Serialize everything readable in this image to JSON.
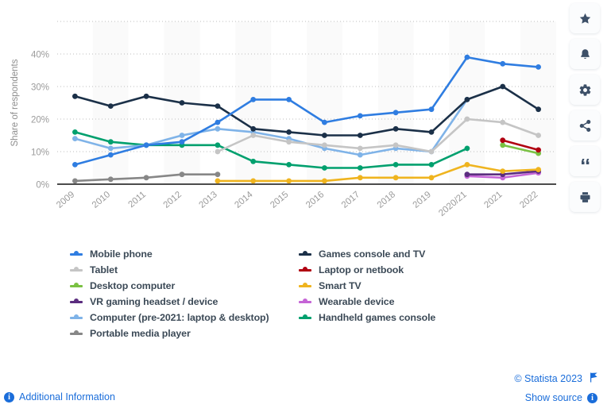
{
  "chart_data": {
    "type": "line",
    "title": "",
    "xlabel": "",
    "ylabel": "Share of respondents",
    "ylim": [
      0,
      50
    ],
    "yticks": [
      0,
      10,
      20,
      30,
      40
    ],
    "ytick_labels": [
      "0%",
      "10%",
      "20%",
      "30%",
      "40%"
    ],
    "grid": true,
    "legend_position": "bottom",
    "categories": [
      "2009",
      "2010",
      "2011",
      "2012",
      "2013",
      "2014",
      "2015",
      "2016",
      "2017",
      "2018",
      "2019",
      "2020/21",
      "2021",
      "2022"
    ],
    "series": [
      {
        "name": "Mobile phone",
        "color": "#2f7de1",
        "values": [
          6,
          9,
          12,
          13,
          19,
          26,
          26,
          19,
          21,
          22,
          23,
          39,
          37,
          36
        ]
      },
      {
        "name": "Games console and TV",
        "color": "#1b3048",
        "values": [
          27,
          24,
          27,
          25,
          24,
          17,
          16,
          15,
          15,
          17,
          16,
          26,
          30,
          23
        ]
      },
      {
        "name": "Tablet",
        "color": "#c5c5c5",
        "values": [
          null,
          null,
          null,
          null,
          10,
          15,
          13,
          12,
          11,
          12,
          10,
          20,
          19,
          15
        ]
      },
      {
        "name": "Laptop or netbook",
        "color": "#b00010",
        "values": [
          null,
          null,
          null,
          null,
          null,
          null,
          null,
          null,
          null,
          null,
          null,
          null,
          13.5,
          10.5
        ]
      },
      {
        "name": "Desktop computer",
        "color": "#7ac143",
        "values": [
          null,
          null,
          null,
          null,
          null,
          null,
          null,
          null,
          null,
          null,
          null,
          null,
          12,
          9.5
        ]
      },
      {
        "name": "Smart TV",
        "color": "#efb41f",
        "values": [
          null,
          null,
          null,
          null,
          1,
          1,
          1,
          1,
          2,
          2,
          2,
          6,
          4,
          4.5
        ]
      },
      {
        "name": "VR gaming headset / device",
        "color": "#5b2d7f",
        "values": [
          null,
          null,
          null,
          null,
          null,
          null,
          null,
          null,
          null,
          null,
          null,
          3,
          3,
          4
        ]
      },
      {
        "name": "Wearable device",
        "color": "#c565d6",
        "values": [
          null,
          null,
          null,
          null,
          null,
          null,
          null,
          null,
          null,
          null,
          null,
          2.5,
          2,
          3.5
        ]
      },
      {
        "name": "Computer (pre-2021: laptop & desktop)",
        "color": "#7fb3e8",
        "values": [
          14,
          11,
          12,
          15,
          17,
          16,
          14,
          11,
          9,
          11,
          10,
          26,
          null,
          null
        ]
      },
      {
        "name": "Handheld games console",
        "color": "#00a06e",
        "values": [
          16,
          13,
          12,
          12,
          12,
          7,
          6,
          5,
          5,
          6,
          6,
          11,
          null,
          null
        ]
      },
      {
        "name": "Portable media player",
        "color": "#878787",
        "values": [
          1,
          1.5,
          2,
          3,
          3,
          null,
          null,
          null,
          null,
          null,
          null,
          null,
          null,
          null
        ]
      }
    ]
  },
  "legend": {
    "rows": [
      {
        "left": {
          "label": "Mobile phone",
          "color": "#2f7de1",
          "name": "mobile-phone"
        },
        "right": {
          "label": "Games console and TV",
          "color": "#1b3048",
          "name": "games-console-and-tv"
        }
      },
      {
        "left": {
          "label": "Tablet",
          "color": "#c5c5c5",
          "name": "tablet"
        },
        "right": {
          "label": "Laptop or netbook",
          "color": "#b00010",
          "name": "laptop-or-netbook"
        }
      },
      {
        "left": {
          "label": "Desktop computer",
          "color": "#7ac143",
          "name": "desktop-computer"
        },
        "right": {
          "label": "Smart TV",
          "color": "#efb41f",
          "name": "smart-tv"
        }
      },
      {
        "left": {
          "label": "VR gaming headset / device",
          "color": "#5b2d7f",
          "name": "vr-gaming-headset"
        },
        "right": {
          "label": "Wearable device",
          "color": "#c565d6",
          "name": "wearable-device"
        }
      },
      {
        "left": {
          "label": "Computer (pre-2021: laptop & desktop)",
          "color": "#7fb3e8",
          "name": "computer"
        },
        "right": {
          "label": "Handheld games console",
          "color": "#00a06e",
          "name": "handheld-games-console"
        }
      },
      {
        "left": {
          "label": "Portable media player",
          "color": "#878787",
          "name": "portable-media-player"
        },
        "right": null
      }
    ]
  },
  "toolbar": {
    "buttons": [
      {
        "name": "favorite-star-icon",
        "label": "star-icon"
      },
      {
        "name": "notification-bell-icon",
        "label": "bell-icon"
      },
      {
        "name": "settings-gear-icon",
        "label": "gear-icon"
      },
      {
        "name": "share-icon",
        "label": "share-icon"
      },
      {
        "name": "citation-quote-icon",
        "label": "quote-icon"
      },
      {
        "name": "print-icon",
        "label": "print-icon"
      }
    ]
  },
  "footer": {
    "copyright": "© Statista 2023",
    "show_source": "Show source",
    "additional_information": "Additional Information",
    "info_glyph": "i",
    "accent_color": "#1a6dda"
  }
}
